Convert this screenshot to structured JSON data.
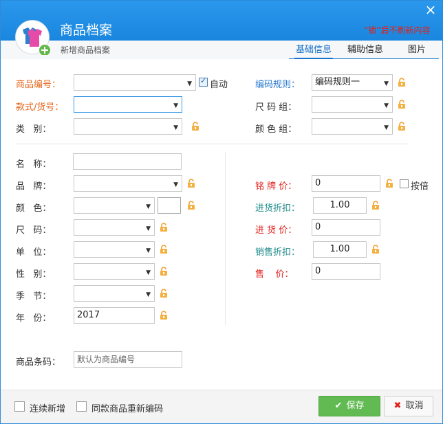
{
  "window": {
    "title": "商品档案",
    "subtitle": "新增商品档案",
    "lock_hint": "“锁”后不刷新内容",
    "close_icon": "×"
  },
  "tabs": [
    {
      "label": "基础信息",
      "active": true
    },
    {
      "label": "辅助信息",
      "active": false
    },
    {
      "label": "图片",
      "active": false
    }
  ],
  "top_left": {
    "code_label": "商品编号：",
    "auto_label": "自动",
    "auto_checked": true,
    "style_label": "款式/货号：",
    "category_label": "类   别："
  },
  "top_right": {
    "rule_label": "编码规则：",
    "rule_value": "编码规则一",
    "size_group_label": "尺 码 组：",
    "color_group_label": "颜 色 组："
  },
  "left": {
    "name_label": "名   称：",
    "brand_label": "品   牌：",
    "color_label": "颜   色：",
    "size_label": "尺   码：",
    "unit_label": "单   位：",
    "gender_label": "性   别：",
    "season_label": "季   节：",
    "year_label": "年   份：",
    "year_value": "2017"
  },
  "right": {
    "tag_price_label": "铭 牌 价：",
    "tag_price_value": "0",
    "by_ratio_label": "按倍",
    "purchase_discount_label": "进货折扣：",
    "purchase_discount_value": "1.00",
    "purchase_price_label": "进 货 价：",
    "purchase_price_value": "0",
    "sales_discount_label": "销售折扣：",
    "sales_discount_value": "1.00",
    "sale_price_label": "售    价：",
    "sale_price_value": "0"
  },
  "barcode": {
    "label": "商品条码：",
    "placeholder": "默认为商品编号"
  },
  "footer": {
    "continuous_add_label": "连续新增",
    "recode_label": "同款商品重新编码",
    "save_label": "保存",
    "cancel_label": "取消"
  },
  "colors": {
    "title_bar": "#1e90e8",
    "orange_label": "#e5651a",
    "blue_label": "#2a7ad1",
    "teal_label": "#1e8a8a",
    "red_label": "#e0211c",
    "save_button": "#62bb52"
  }
}
